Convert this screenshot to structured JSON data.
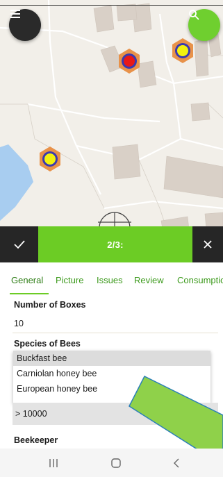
{
  "map": {
    "menu_icon": "hamburger-menu-icon",
    "search_icon": "search-icon",
    "colors": {
      "background": "#f2efe9",
      "building": "#d9d0c7",
      "water": "#a8cdf0",
      "marker_outer": "#e8924a",
      "marker_ring": "#3a3ab0",
      "marker_yellow": "#f2f20f",
      "marker_red": "#e81818"
    }
  },
  "action_bar": {
    "confirm_icon": "checkmark-icon",
    "counter": "2/3:",
    "close_icon": "close-icon",
    "accent": "#6ccc25"
  },
  "tabs": [
    "General",
    "Picture",
    "Issues",
    "Review",
    "Consumption"
  ],
  "form": {
    "boxes_label": "Number of Boxes",
    "boxes_value": "10",
    "species_label": "Species of Bees",
    "species_options": [
      "Buckfast bee",
      "Carniolan honey bee",
      "European honey bee"
    ],
    "amount_value": "> 10000",
    "beekeeper_label": "Beekeeper"
  },
  "nav": {
    "recents_icon": "recent-apps-icon",
    "home_icon": "home-icon",
    "back_icon": "back-icon"
  }
}
